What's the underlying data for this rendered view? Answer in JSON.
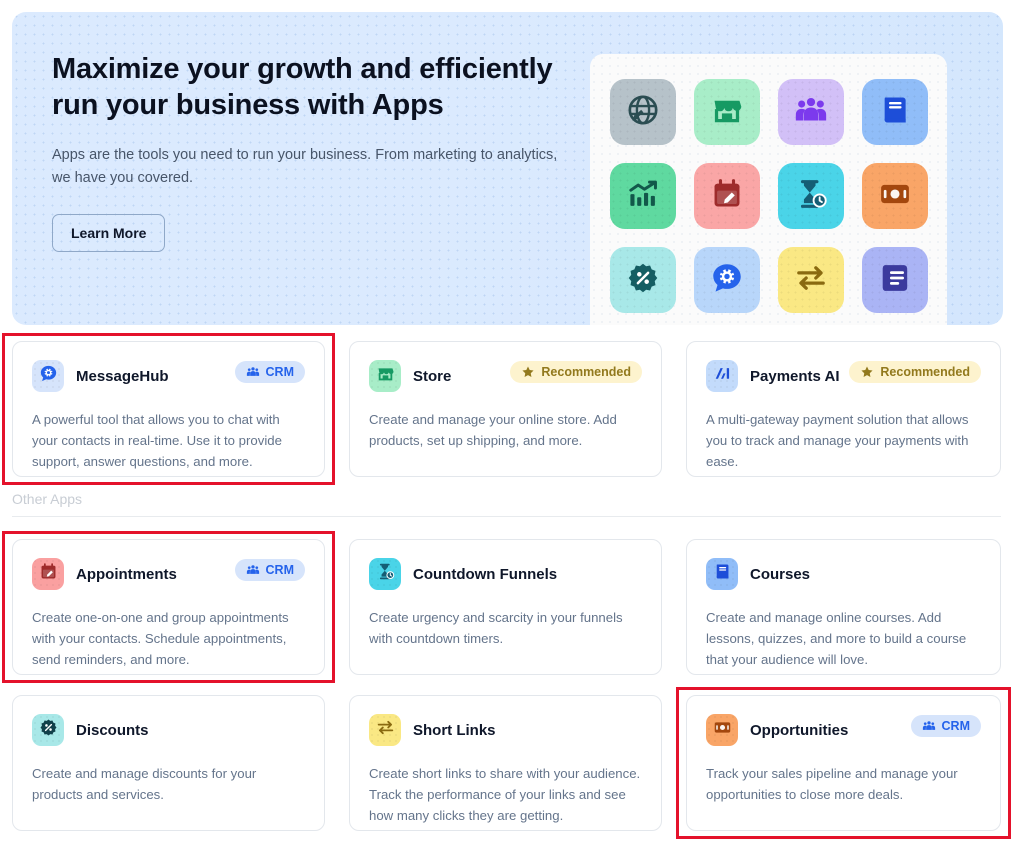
{
  "hero": {
    "title": "Maximize your growth and efficiently run your business with Apps",
    "subtitle": "Apps are the tools you need to run your business. From marketing to analytics, we have you covered.",
    "cta_label": "Learn More",
    "background_color": "#dbeafe",
    "icon_tiles": [
      {
        "name": "globe-icon",
        "bg": "#b6c2c9",
        "fg": "#2b4d52"
      },
      {
        "name": "store-icon",
        "bg": "#a8edc8",
        "fg": "#169a63"
      },
      {
        "name": "people-icon",
        "bg": "#d2c0f7",
        "fg": "#7c3aed"
      },
      {
        "name": "book-icon",
        "bg": "#90bdf8",
        "fg": "#1d4ed8"
      },
      {
        "name": "analytics-icon",
        "bg": "#5fd9a0",
        "fg": "#12584a"
      },
      {
        "name": "calendar-edit-icon",
        "bg": "#faa6a6",
        "fg": "#9e2b2b"
      },
      {
        "name": "hourglass-timer-icon",
        "bg": "#4ad4e8",
        "fg": "#155e75"
      },
      {
        "name": "money-icon",
        "bg": "#f9a567",
        "fg": "#a3470e"
      },
      {
        "name": "discount-icon",
        "bg": "#a8e8e8",
        "fg": "#155e63"
      },
      {
        "name": "chat-gear-icon",
        "bg": "#b8d6fa",
        "fg": "#2563eb"
      },
      {
        "name": "transfer-icon",
        "bg": "#fae884",
        "fg": "#8a6a10"
      },
      {
        "name": "list-icon",
        "bg": "#aab4f5",
        "fg": "#3b3a9e"
      }
    ]
  },
  "featured_apps": [
    {
      "name": "MessageHub",
      "description": "A powerful tool that allows you to chat with your contacts in real-time. Use it to provide support, answer questions, and more.",
      "badge": "CRM",
      "badge_type": "crm",
      "icon": "chat-gear-icon",
      "icon_bg": "#d6e4fb",
      "icon_fg": "#2563eb",
      "highlighted": true
    },
    {
      "name": "Store",
      "description": "Create and manage your online store. Add products, set up shipping, and more.",
      "badge": "Recommended",
      "badge_type": "recommended",
      "icon": "store-icon",
      "icon_bg": "#a8edc8",
      "icon_fg": "#169a63",
      "highlighted": false
    },
    {
      "name": "Payments AI",
      "description": "A multi-gateway payment solution that allows you to track and manage your payments with ease.",
      "badge": "Recommended",
      "badge_type": "recommended",
      "icon": "ai-logo-icon",
      "icon_bg": "#c3dbfb",
      "icon_fg": "#1d4ed8",
      "highlighted": false
    }
  ],
  "other_section": {
    "title": "Other Apps"
  },
  "other_apps": [
    {
      "name": "Appointments",
      "description": "Create one-on-one and group appointments with your contacts. Schedule appointments, send reminders, and more.",
      "badge": "CRM",
      "badge_type": "crm",
      "icon": "calendar-edit-icon",
      "icon_bg": "#faa0a0",
      "icon_fg": "#9e2b2b",
      "highlighted": true
    },
    {
      "name": "Countdown Funnels",
      "description": "Create urgency and scarcity in your funnels with countdown timers.",
      "badge": "",
      "badge_type": "none",
      "icon": "hourglass-timer-icon",
      "icon_bg": "#4ad4e8",
      "icon_fg": "#155e75",
      "highlighted": false
    },
    {
      "name": "Courses",
      "description": "Create and manage online courses. Add lessons, quizzes, and more to build a course that your audience will love.",
      "badge": "",
      "badge_type": "none",
      "icon": "book-icon",
      "icon_bg": "#90bdf8",
      "icon_fg": "#1d4ed8",
      "highlighted": false
    },
    {
      "name": "Discounts",
      "description": "Create and manage discounts for your products and services.",
      "badge": "",
      "badge_type": "none",
      "icon": "discount-icon",
      "icon_bg": "#a8e8e8",
      "icon_fg": "#11404a",
      "highlighted": false
    },
    {
      "name": "Short Links",
      "description": "Create short links to share with your audience. Track the performance of your links and see how many clicks they are getting.",
      "badge": "",
      "badge_type": "none",
      "icon": "transfer-icon",
      "icon_bg": "#fae884",
      "icon_fg": "#8a6a10",
      "highlighted": false
    },
    {
      "name": "Opportunities",
      "description": "Track your sales pipeline and manage your opportunities to close more deals.",
      "badge": "CRM",
      "badge_type": "crm",
      "icon": "money-icon",
      "icon_bg": "#f9a567",
      "icon_fg": "#a3470e",
      "highlighted": true
    }
  ],
  "colors": {
    "highlight_border": "#e4122b",
    "crm_badge_bg": "#d6e4fb",
    "crm_badge_text": "#2563eb",
    "recommended_badge_bg": "#fdf3ce",
    "recommended_badge_text": "#92791d"
  }
}
